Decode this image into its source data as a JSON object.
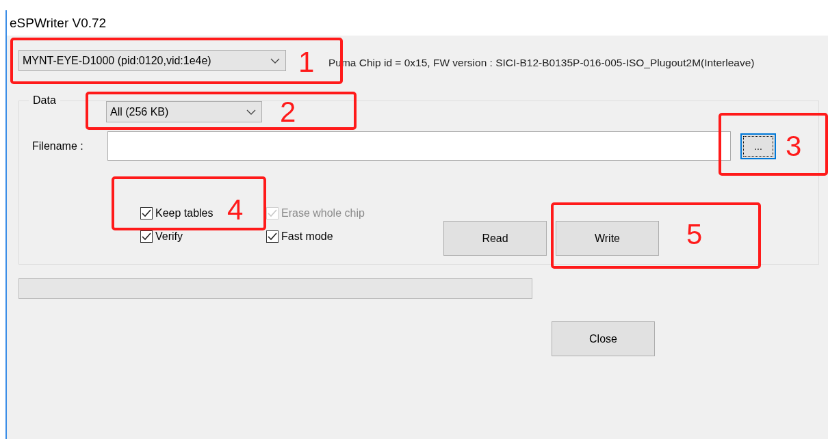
{
  "window": {
    "title": "eSPWriter V0.72"
  },
  "device_select": {
    "value": "MYNT-EYE-D1000 (pid:0120,vid:1e4e)"
  },
  "chip_info": "Puma Chip id = 0x15, FW version : SICI-B12-B0135P-016-005-ISO_Plugout2M(Interleave)",
  "data_group": {
    "title": "Data",
    "range_select": {
      "value": "All (256 KB)"
    },
    "filename_label": "Filename :",
    "browse_button": "...",
    "options": [
      {
        "label": "Keep tables",
        "checked": true,
        "disabled": false
      },
      {
        "label": "Erase whole chip",
        "checked": true,
        "disabled": true
      },
      {
        "label": "Verify",
        "checked": true,
        "disabled": false
      },
      {
        "label": "Fast mode",
        "checked": true,
        "disabled": false
      }
    ],
    "buttons": [
      "Read",
      "Write"
    ]
  },
  "progress": {
    "level": 0
  },
  "close_button": "Close",
  "annotations": [
    {
      "label": "1"
    },
    {
      "label": "2"
    },
    {
      "label": "3"
    },
    {
      "label": "4"
    },
    {
      "label": "5"
    }
  ]
}
